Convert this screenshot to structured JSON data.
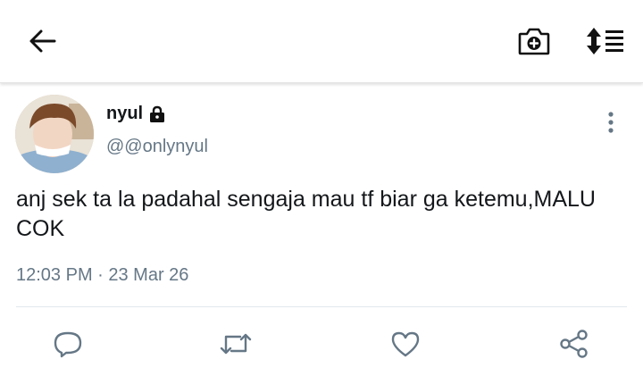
{
  "app_bar": {
    "back_icon": "arrow-left-icon",
    "camera_icon": "camera-add-icon",
    "sort_icon": "sort-list-icon"
  },
  "tweet": {
    "display_name": "nyul",
    "locked_icon": "lock-icon",
    "handle": "@@onlynyul",
    "text": "anj sek ta la padahal sengaja mau tf biar ga ketemu,MALU COK",
    "timestamp": "12:03 PM · 23 Mar 26",
    "overflow_icon": "more-vertical-icon"
  },
  "actions": [
    {
      "name": "reply",
      "icon": "comment-icon"
    },
    {
      "name": "retweet",
      "icon": "retweet-icon"
    },
    {
      "name": "like",
      "icon": "heart-icon"
    },
    {
      "name": "share",
      "icon": "share-icon"
    }
  ],
  "colors": {
    "text_primary": "#14171a",
    "text_secondary": "#657786",
    "icon_gray": "#657786",
    "divider": "#e1e8ed"
  }
}
